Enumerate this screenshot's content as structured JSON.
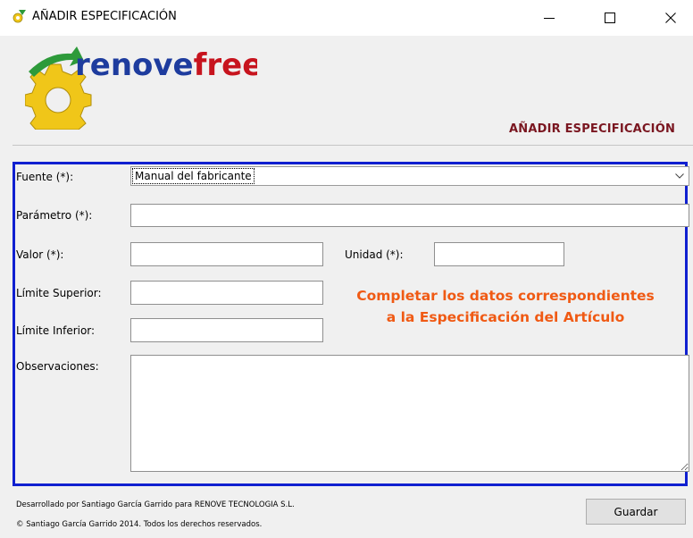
{
  "window": {
    "title": "AÑADIR ESPECIFICACIÓN",
    "controls": {
      "minimize": "minimize-icon",
      "maximize": "maximize-icon",
      "close": "close-icon"
    }
  },
  "header": {
    "logo_text_main": "renove",
    "logo_text_accent": "free",
    "logo_colors": {
      "main": "#1e3c9e",
      "accent": "#c7141e",
      "gear": "#f0c619"
    },
    "title": "AÑADIR ESPECIFICACIÓN",
    "title_color": "#7a1620"
  },
  "form": {
    "frame_color": "#1020d0",
    "fuente": {
      "label": "Fuente (*):",
      "value": "Manual del fabricante",
      "icon": "chevron-down-icon"
    },
    "parametro": {
      "label": "Parámetro (*):",
      "value": ""
    },
    "valor": {
      "label": "Valor (*):",
      "value": ""
    },
    "unidad": {
      "label": "Unidad (*):",
      "value": ""
    },
    "limite_superior": {
      "label": "Límite Superior:",
      "value": ""
    },
    "limite_inferior": {
      "label": "Límite Inferior:",
      "value": ""
    },
    "observaciones": {
      "label": "Observaciones:",
      "value": ""
    },
    "hint": {
      "line1": "Completar los datos correspondientes",
      "line2": "a la Especificación del Artículo",
      "color": "#f05a14"
    }
  },
  "footer": {
    "line1": "Desarrollado por Santiago García Garrido para RENOVE TECNOLOGIA S.L.",
    "line2": "© Santiago García Garrido 2014. Todos los derechos reservados."
  },
  "actions": {
    "save_label": "Guardar"
  }
}
